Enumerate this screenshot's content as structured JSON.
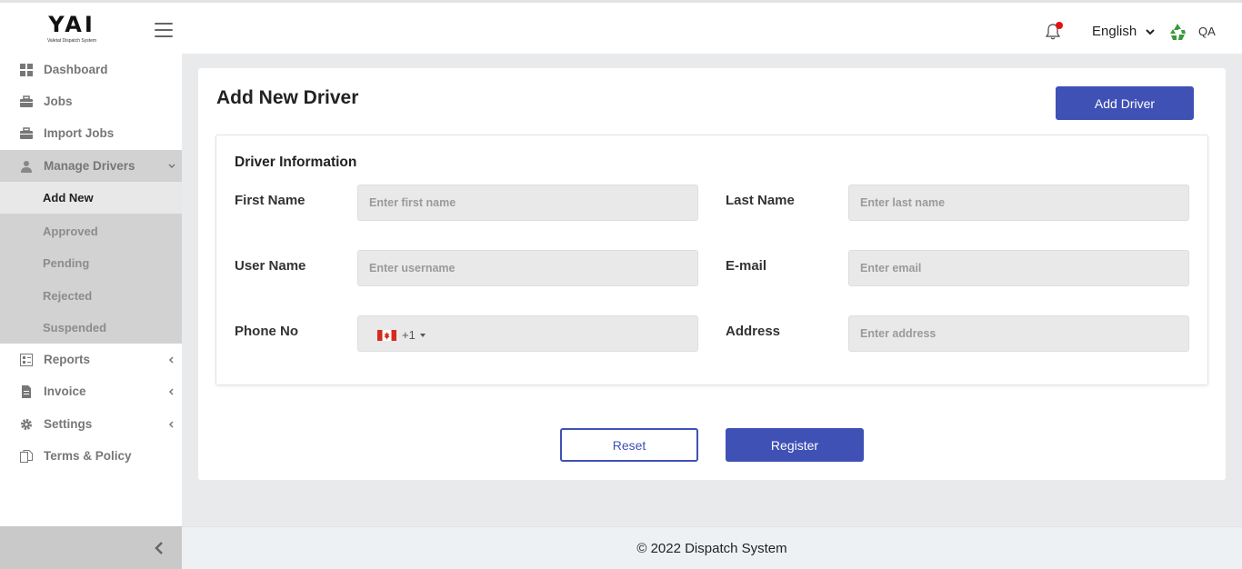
{
  "header": {
    "logo_mark": "YAI",
    "logo_subtitle": "Valetat Dispatch System",
    "language": "English",
    "user_initials": "QA"
  },
  "sidebar": {
    "items": [
      {
        "label": "Dashboard",
        "icon": "dashboard-icon"
      },
      {
        "label": "Jobs",
        "icon": "briefcase-icon"
      },
      {
        "label": "Import Jobs",
        "icon": "briefcase-icon"
      },
      {
        "label": "Manage Drivers",
        "icon": "user-icon"
      },
      {
        "label": "Reports",
        "icon": "report-icon"
      },
      {
        "label": "Invoice",
        "icon": "document-icon"
      },
      {
        "label": "Settings",
        "icon": "gear-icon"
      },
      {
        "label": "Terms & Policy",
        "icon": "copy-icon"
      }
    ],
    "submenu": [
      {
        "label": "Add New",
        "active": true
      },
      {
        "label": "Approved",
        "active": false
      },
      {
        "label": "Pending",
        "active": false
      },
      {
        "label": "Rejected",
        "active": false
      },
      {
        "label": "Suspended",
        "active": false
      }
    ]
  },
  "main": {
    "title": "Add New Driver",
    "add_driver_label": "Add Driver",
    "section_title": "Driver Information",
    "fields": {
      "first_name": {
        "label": "First Name",
        "placeholder": "Enter first name"
      },
      "last_name": {
        "label": "Last Name",
        "placeholder": "Enter last name"
      },
      "user_name": {
        "label": "User Name",
        "placeholder": "Enter username"
      },
      "email": {
        "label": "E-mail",
        "placeholder": "Enter email"
      },
      "phone": {
        "label": "Phone No",
        "dial_code": "+1",
        "country": "Canada"
      },
      "address": {
        "label": "Address",
        "placeholder": "Enter address"
      }
    },
    "reset_label": "Reset",
    "register_label": "Register"
  },
  "footer": {
    "text": "© 2022 Dispatch System"
  },
  "colors": {
    "primary": "#3f51b5",
    "notification_dot": "#e01212",
    "sidebar_active_group": "#d2d2d2",
    "recycle_green": "#3a9a3a"
  }
}
